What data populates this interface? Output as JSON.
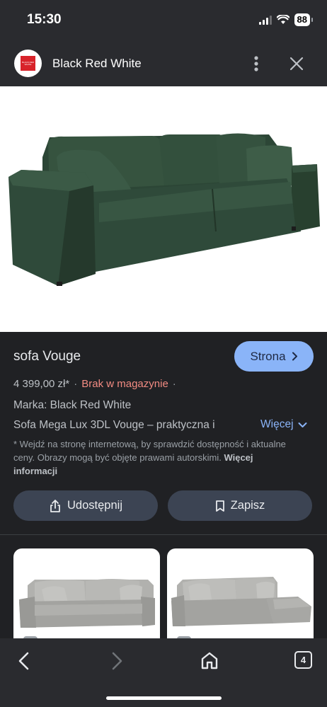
{
  "status_bar": {
    "time": "15:30",
    "battery": "88"
  },
  "header": {
    "site_name": "Black Red White",
    "logo_text": "BLACK RED WHITE",
    "more_icon": "more-vert-icon",
    "close_icon": "close-icon"
  },
  "product": {
    "title": "sofa Vouge",
    "visit_label": "Strona",
    "price": "4 399,00 zł*",
    "stock": "Brak w magazynie",
    "brand": "Marka: Black Red White",
    "description": "Sofa Mega Lux 3DL Vouge – praktyczna i",
    "more_label": "Więcej",
    "disclaimer": "* Wejdź na stronę internetową, by sprawdzić dostępność i aktualne ceny. Obrazy mogą być objęte prawami autorskimi.",
    "disclaimer_link": "Więcej informacji"
  },
  "actions": {
    "share_label": "Udostępnij",
    "save_label": "Zapisz"
  },
  "bottom_nav": {
    "tabs_count": "4"
  },
  "colors": {
    "background": "#202124",
    "accent": "#8ab4f8",
    "stock_status": "#f28b82",
    "sofa_green": "#2f4a3a",
    "sofa_grey": "#a3a3a0",
    "brand_red": "#d8232a"
  }
}
